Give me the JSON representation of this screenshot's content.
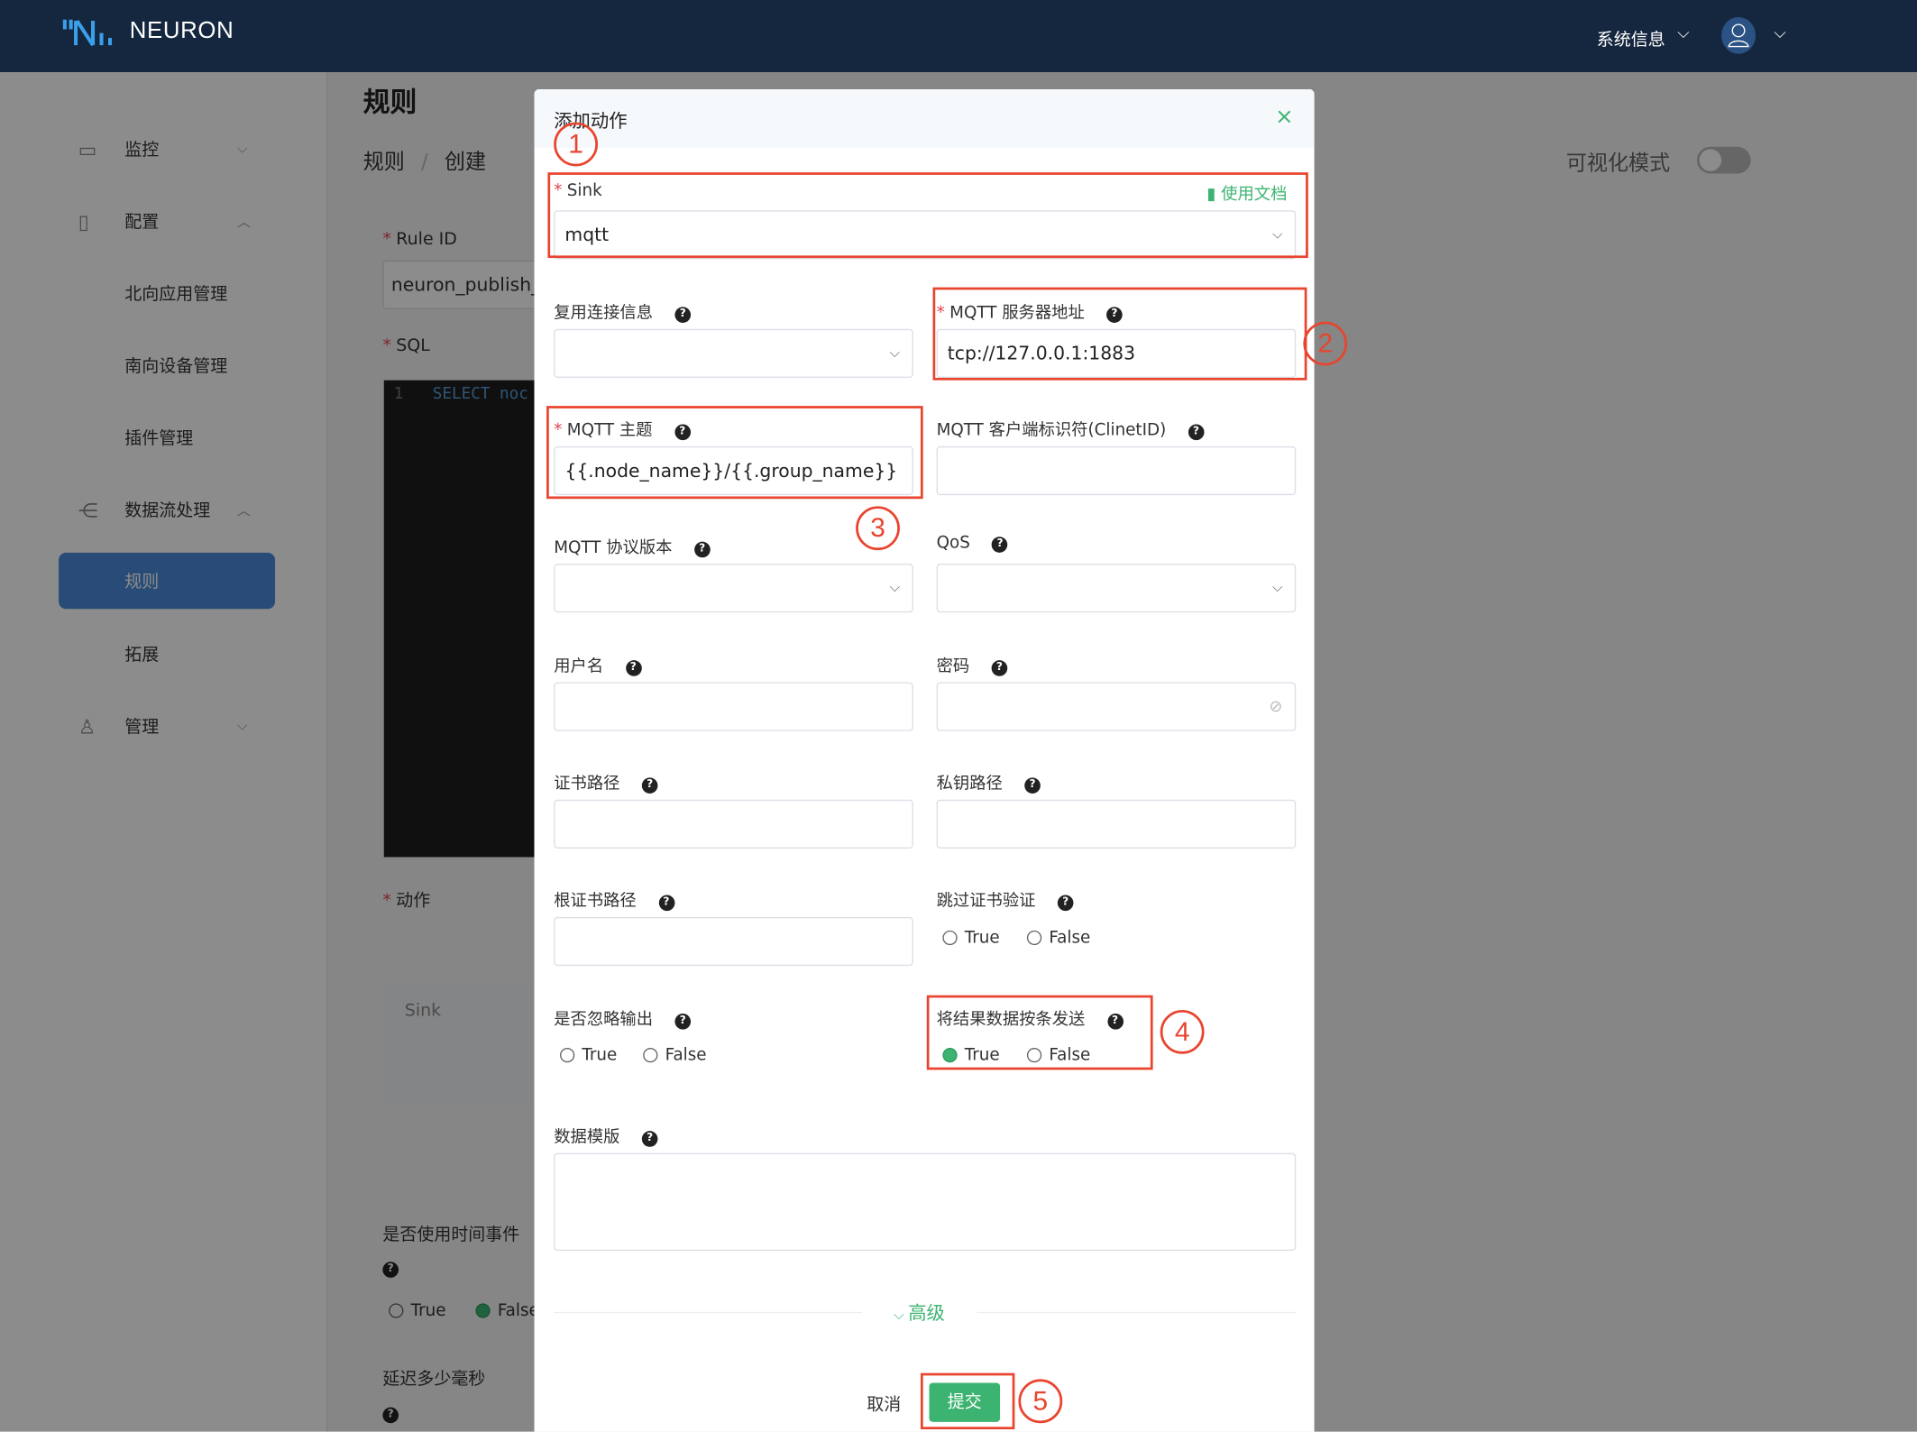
{
  "header": {
    "brand": "NEURON",
    "system_info": "系统信息",
    "chevron": "⌵"
  },
  "sidebar": {
    "items": [
      {
        "label": "监控",
        "icon": "monitor-icon",
        "chevron": "⌵"
      },
      {
        "label": "配置",
        "icon": "config-icon",
        "chevron": "︿"
      },
      {
        "label": "北向应用管理"
      },
      {
        "label": "南向设备管理"
      },
      {
        "label": "插件管理"
      },
      {
        "label": "数据流处理",
        "icon": "dataflow-icon",
        "chevron": "︿"
      },
      {
        "label": "规则",
        "active": true
      },
      {
        "label": "拓展"
      },
      {
        "label": "管理",
        "icon": "user-icon",
        "chevron": "⌵"
      }
    ]
  },
  "page": {
    "title": "规则",
    "breadcrumb": [
      "规则",
      "创建"
    ],
    "breadcrumb_sep": "/",
    "visual_mode": "可视化模式",
    "visual_mode_on": false,
    "rule_id_label": "Rule ID",
    "rule_id_value": "neuron_publish_",
    "sql_label": "SQL",
    "sql_line_no": "1",
    "sql_code": "SELECT noc",
    "actions_label": "动作",
    "sink_card": "Sink",
    "time_event_label": "是否使用时间事件",
    "time_event_true": "True",
    "time_event_false": "False",
    "time_event_selected": "False",
    "delay_label": "延迟多少毫秒"
  },
  "modal": {
    "title": "添加动作",
    "close": "×",
    "sink_label": "Sink",
    "docs_link": "使用文档",
    "sink_value": "mqtt",
    "reuse_label": "复用连接信息",
    "reuse_value": "",
    "server_label": "MQTT 服务器地址",
    "server_value": "tcp://127.0.0.1:1883",
    "topic_label": "MQTT 主题",
    "topic_value": "{{.node_name}}/{{.group_name}}",
    "clientid_label": "MQTT 客户端标识符(ClinetID)",
    "clientid_value": "",
    "protocol_label": "MQTT 协议版本",
    "protocol_value": "",
    "qos_label": "QoS",
    "qos_value": "",
    "username_label": "用户名",
    "username_value": "",
    "password_label": "密码",
    "password_value": "",
    "cert_label": "证书路径",
    "key_label": "私钥路径",
    "rootcert_label": "根证书路径",
    "skip_verify_label": "跳过证书验证",
    "skip_verify_selected": null,
    "omit_label": "是否忽略输出",
    "omit_selected": null,
    "send_single_label": "将结果数据按条发送",
    "send_single_selected": "True",
    "true_label": "True",
    "false_label": "False",
    "template_label": "数据模版",
    "template_value": "",
    "advanced": "高级",
    "cancel": "取消",
    "submit": "提交",
    "annotations": [
      "1",
      "2",
      "3",
      "4",
      "5"
    ],
    "accent_color": "#3cb371",
    "annotation_color": "#e8442e"
  }
}
